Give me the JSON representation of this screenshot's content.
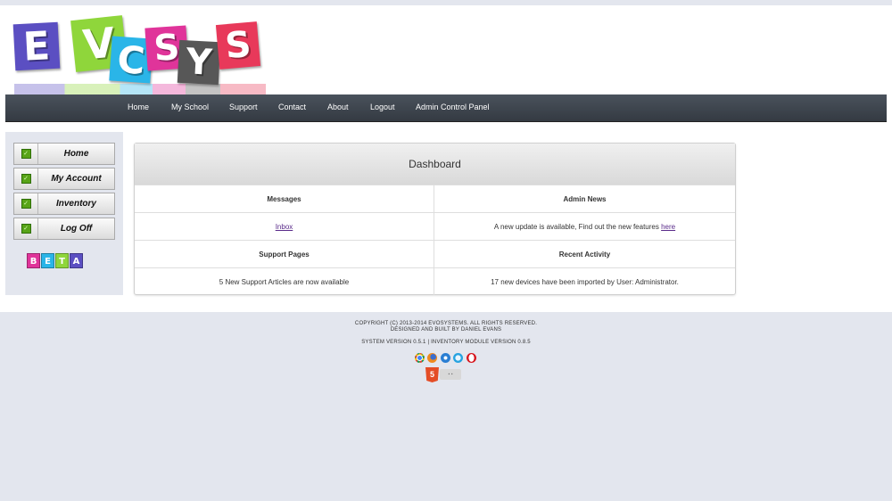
{
  "logo": {
    "letters": [
      "E",
      "V",
      "C",
      "S",
      "Y",
      "S"
    ],
    "colors": [
      "#5b4fc2",
      "#8fd63b",
      "#2ab5e8",
      "#e0349a",
      "#575757",
      "#e8395a"
    ]
  },
  "nav": {
    "items": [
      {
        "label": "Home"
      },
      {
        "label": "My School"
      },
      {
        "label": "Support"
      },
      {
        "label": "Contact"
      },
      {
        "label": "About"
      },
      {
        "label": "Logout"
      },
      {
        "label": "Admin Control Panel"
      }
    ]
  },
  "sidebar": {
    "items": [
      {
        "label": "Home"
      },
      {
        "label": "My Account"
      },
      {
        "label": "Inventory"
      },
      {
        "label": "Log Off"
      }
    ],
    "beta": {
      "letters": [
        "B",
        "E",
        "T",
        "A"
      ],
      "colors": [
        "#e0349a",
        "#2ab5e8",
        "#8fd63b",
        "#5b4fc2"
      ]
    }
  },
  "dashboard": {
    "title": "Dashboard",
    "messages_header": "Messages",
    "inbox_link": "Inbox",
    "admin_news_header": "Admin News",
    "admin_news_text": "A new update is available, Find out the new features",
    "admin_news_link": "here",
    "support_header": "Support Pages",
    "support_text": "5 New Support Articles are now available",
    "activity_header": "Recent Activity",
    "activity_text": "17 new devices have been imported by User: Administrator."
  },
  "footer": {
    "copyright": "COPYRIGHT (C) 2013-2014 EVOSYSTEMS. ALL RIGHTS RESERVED.",
    "designed": "DESIGNED AND BUILT BY DANIEL EVANS",
    "version": "SYSTEM VERSION 0.5.1 | INVENTORY MODULE VERSION 0.8.5",
    "browser_icons": [
      "chrome-icon",
      "firefox-icon",
      "ie-icon",
      "safari-icon",
      "opera-icon"
    ],
    "html5_label": "5"
  },
  "colors": {
    "navbar": "#3d444d",
    "page_bg": "#e3e6ee",
    "link": "#5a2b8a"
  }
}
